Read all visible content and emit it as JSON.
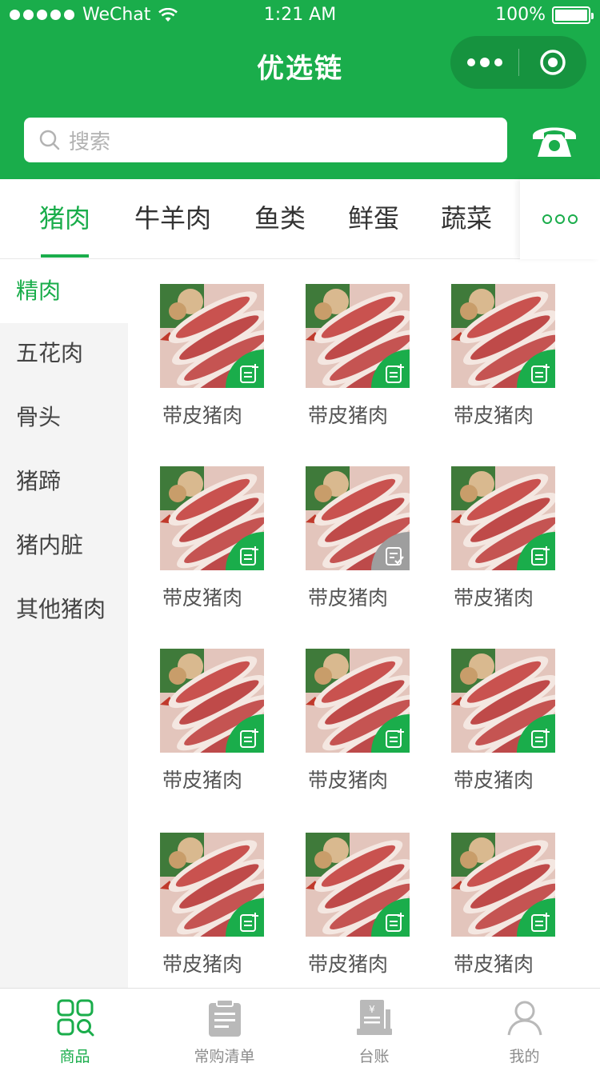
{
  "status_bar": {
    "carrier": "WeChat",
    "time": "1:21 AM",
    "battery": "100%"
  },
  "nav": {
    "title": "优选链"
  },
  "search": {
    "placeholder": "搜索"
  },
  "categories": [
    {
      "label": "猪肉",
      "active": true
    },
    {
      "label": "牛羊肉"
    },
    {
      "label": "鱼类"
    },
    {
      "label": "鲜蛋"
    },
    {
      "label": "蔬菜"
    }
  ],
  "subcategories": [
    {
      "label": "精肉",
      "active": true
    },
    {
      "label": "五花肉"
    },
    {
      "label": "骨头"
    },
    {
      "label": "猪蹄"
    },
    {
      "label": "猪内脏"
    },
    {
      "label": "其他猪肉"
    }
  ],
  "products": [
    {
      "name": "带皮猪肉",
      "in_list": false
    },
    {
      "name": "带皮猪肉",
      "in_list": false
    },
    {
      "name": "带皮猪肉",
      "in_list": false
    },
    {
      "name": "带皮猪肉",
      "in_list": false
    },
    {
      "name": "带皮猪肉",
      "in_list": true
    },
    {
      "name": "带皮猪肉",
      "in_list": false
    },
    {
      "name": "带皮猪肉",
      "in_list": false
    },
    {
      "name": "带皮猪肉",
      "in_list": false
    },
    {
      "name": "带皮猪肉",
      "in_list": false
    },
    {
      "name": "带皮猪肉",
      "in_list": false
    },
    {
      "name": "带皮猪肉",
      "in_list": false
    },
    {
      "name": "带皮猪肉",
      "in_list": false
    }
  ],
  "tabbar": [
    {
      "label": "商品",
      "icon": "grid-search-icon",
      "active": true
    },
    {
      "label": "常购清单",
      "icon": "clipboard-icon"
    },
    {
      "label": "台账",
      "icon": "ledger-icon"
    },
    {
      "label": "我的",
      "icon": "user-icon"
    }
  ],
  "colors": {
    "brand": "#1aad4b",
    "sidebar_bg": "#f4f4f4",
    "badge_added": "#9e9e9e"
  }
}
